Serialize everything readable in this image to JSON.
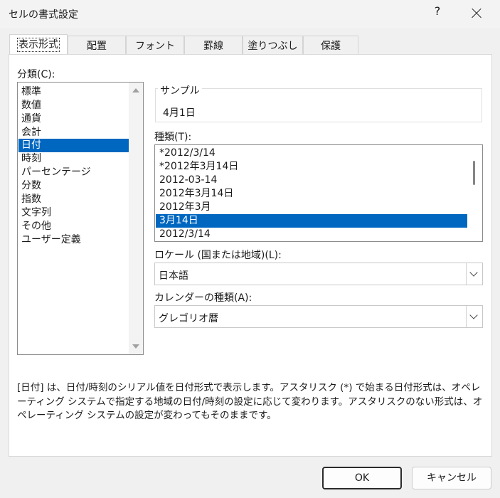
{
  "window": {
    "title": "セルの書式設定",
    "help": "?"
  },
  "tabs": [
    "表示形式",
    "配置",
    "フォント",
    "罫線",
    "塗りつぶし",
    "保護"
  ],
  "category": {
    "label": "分類(C):",
    "items": [
      "標準",
      "数値",
      "通貨",
      "会計",
      "日付",
      "時刻",
      "パーセンテージ",
      "分数",
      "指数",
      "文字列",
      "その他",
      "ユーザー定義"
    ],
    "selected": "日付"
  },
  "sample": {
    "label": "サンプル",
    "value": "4月1日"
  },
  "type": {
    "label": "種類(T):",
    "items": [
      "*2012/3/14",
      "*2012年3月14日",
      "2012-03-14",
      "2012年3月14日",
      "2012年3月",
      "3月14日",
      "2012/3/14"
    ],
    "selected": "3月14日"
  },
  "locale": {
    "label": "ロケール (国または地域)(L):",
    "value": "日本語"
  },
  "calendar": {
    "label": "カレンダーの種類(A):",
    "value": "グレゴリオ暦"
  },
  "description": "[日付] は、日付/時刻のシリアル値を日付形式で表示します。アスタリスク (*) で始まる日付形式は、オペレーティング システムで指定する地域の日付/時刻の設定に応じて変わります。アスタリスクのない形式は、オペレーティング システムの設定が変わってもそのままです。",
  "buttons": {
    "ok": "OK",
    "cancel": "キャンセル"
  }
}
